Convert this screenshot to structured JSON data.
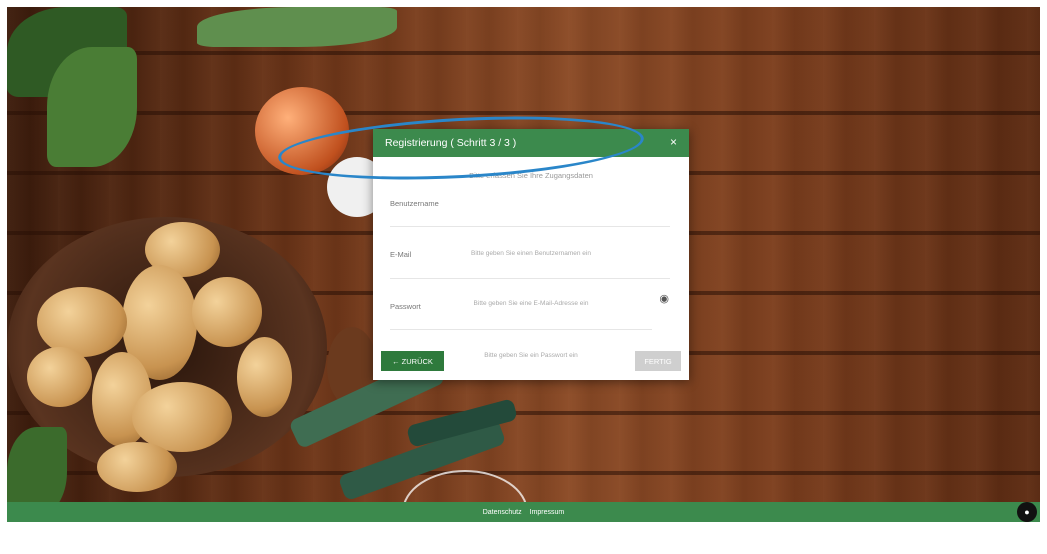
{
  "modal": {
    "title": "Registrierung ( Schritt 3 / 3 )",
    "close_icon": "×",
    "intro": "Bitte erfassen Sie Ihre Zugangsdaten",
    "fields": {
      "username": {
        "label": "Benutzername",
        "hint": "Bitte geben Sie einen Benutzernamen ein"
      },
      "email": {
        "label": "E-Mail",
        "hint": "Bitte geben Sie eine E-Mail-Adresse ein"
      },
      "password": {
        "label": "Passwort",
        "hint": "Bitte geben Sie ein Passwort ein",
        "toggle_icon": "eye-icon"
      }
    },
    "back_button": "← ZURÜCK",
    "done_button": "FERTIG"
  },
  "footer": {
    "privacy": "Datenschutz",
    "imprint": "Impressum"
  },
  "colors": {
    "header_green": "#3c8a4d",
    "button_green": "#2e7a3c",
    "annotation_blue": "#2a86c9"
  }
}
